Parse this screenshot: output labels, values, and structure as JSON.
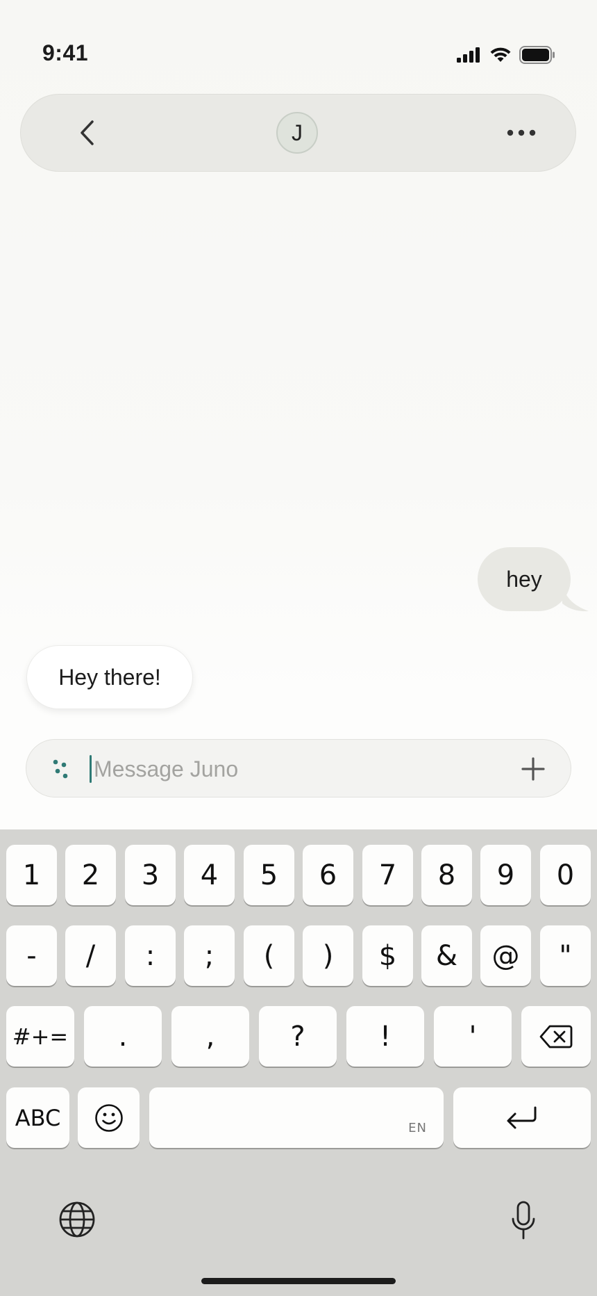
{
  "status_bar": {
    "time": "9:41"
  },
  "header": {
    "avatar_initial": "J"
  },
  "messages": [
    {
      "role": "user",
      "text": "hey"
    },
    {
      "role": "assistant",
      "text": "Hey there!"
    }
  ],
  "composer": {
    "placeholder": "Message Juno",
    "value": ""
  },
  "keyboard": {
    "row1": [
      "1",
      "2",
      "3",
      "4",
      "5",
      "6",
      "7",
      "8",
      "9",
      "0"
    ],
    "row2": [
      "-",
      "/",
      ":",
      ";",
      "(",
      ")",
      "$",
      "&",
      "@",
      "\""
    ],
    "row3": [
      "#+=",
      ".",
      ",",
      "?",
      "!",
      "'"
    ],
    "abc_label": "ABC",
    "space_lang": "EN"
  },
  "colors": {
    "accent": "#2f7a75",
    "user_bubble": "#e8e8e3",
    "keyboard_bg": "#d4d4d1"
  }
}
